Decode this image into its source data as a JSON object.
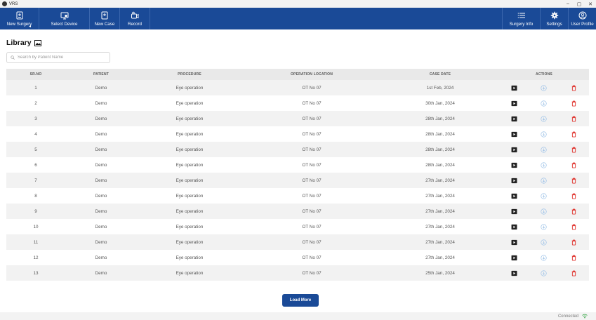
{
  "window": {
    "title": "VRS",
    "controls": [
      "–",
      "▢",
      "✕"
    ]
  },
  "toolbar": {
    "left": [
      {
        "label": "New Surgery",
        "icon": "new-surgery-icon"
      },
      {
        "label": "Select Device",
        "icon": "select-device-icon"
      },
      {
        "label": "New Case",
        "icon": "new-case-icon"
      },
      {
        "label": "Record",
        "icon": "record-icon"
      }
    ],
    "right": [
      {
        "label": "Surgery Info",
        "icon": "list-icon"
      },
      {
        "label": "Settings",
        "icon": "gear-icon"
      },
      {
        "label": "User Profile",
        "icon": "user-icon"
      }
    ],
    "caret": "◂"
  },
  "library": {
    "title": "Library",
    "search_placeholder": "Search by Patient Name",
    "columns": [
      "SR.NO",
      "PATIENT",
      "PROCEDURE",
      "OPERATION LOCATION",
      "CASE DATE",
      "ACTIONS"
    ],
    "rows": [
      {
        "sr": "1",
        "patient": "Demo",
        "procedure": "Eye operation",
        "location": "OT No 07",
        "date": "1st Feb, 2024"
      },
      {
        "sr": "2",
        "patient": "Demo",
        "procedure": "Eye operation",
        "location": "OT No 07",
        "date": "30th Jan, 2024"
      },
      {
        "sr": "3",
        "patient": "Demo",
        "procedure": "Eye operation",
        "location": "OT No 07",
        "date": "28th Jan, 2024"
      },
      {
        "sr": "4",
        "patient": "Demo",
        "procedure": "Eye operation",
        "location": "OT No 07",
        "date": "28th Jan, 2024"
      },
      {
        "sr": "5",
        "patient": "Demo",
        "procedure": "Eye operation",
        "location": "OT No 07",
        "date": "28th Jan, 2024"
      },
      {
        "sr": "6",
        "patient": "Demo",
        "procedure": "Eye operation",
        "location": "OT No 07",
        "date": "28th Jan, 2024"
      },
      {
        "sr": "7",
        "patient": "Demo",
        "procedure": "Eye operation",
        "location": "OT No 07",
        "date": "27th Jan, 2024"
      },
      {
        "sr": "8",
        "patient": "Demo",
        "procedure": "Eye operation",
        "location": "OT No 07",
        "date": "27th Jan, 2024"
      },
      {
        "sr": "9",
        "patient": "Demo",
        "procedure": "Eye operation",
        "location": "OT No 07",
        "date": "27th Jan, 2024"
      },
      {
        "sr": "10",
        "patient": "Demo",
        "procedure": "Eye operation",
        "location": "OT No 07",
        "date": "27th Jan, 2024"
      },
      {
        "sr": "11",
        "patient": "Demo",
        "procedure": "Eye operation",
        "location": "OT No 07",
        "date": "27th Jan, 2024"
      },
      {
        "sr": "12",
        "patient": "Demo",
        "procedure": "Eye operation",
        "location": "OT No 07",
        "date": "27th Jan, 2024"
      },
      {
        "sr": "13",
        "patient": "Demo",
        "procedure": "Eye operation",
        "location": "OT No 07",
        "date": "25th Jan, 2024"
      }
    ],
    "actions": [
      "play-icon",
      "download-icon",
      "delete-icon"
    ],
    "load_more": "Load More"
  },
  "status": {
    "text": "Connected",
    "icon": "wifi-icon"
  },
  "colors": {
    "primary": "#1a4a97",
    "delete": "#e0322c",
    "download": "#9fc3e8",
    "stripe": "#f2f2f2"
  }
}
